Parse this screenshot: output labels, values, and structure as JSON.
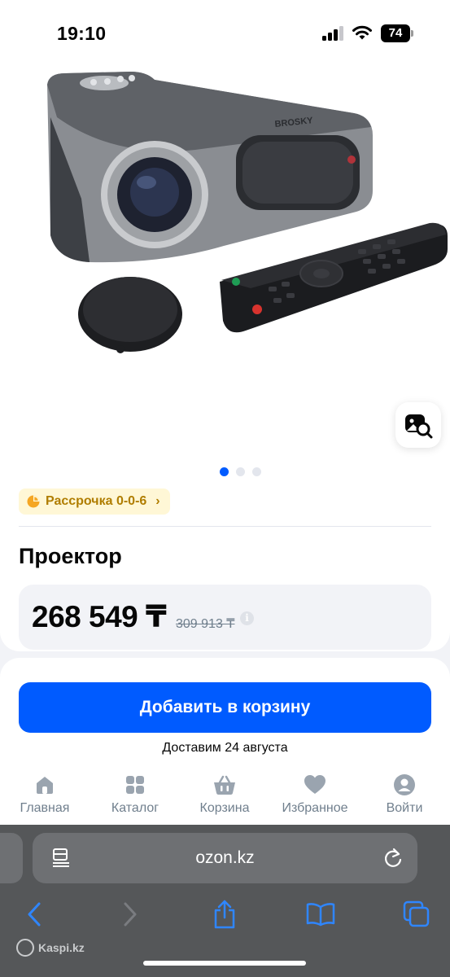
{
  "status_bar": {
    "time": "19:10",
    "battery": "74"
  },
  "product": {
    "installment_label": "Рассрочка 0-0-6",
    "title": "Проектор",
    "price": "268 549 ₸",
    "old_price": "309 913 ₸",
    "brand_on_image": "BROSKY"
  },
  "gallery": {
    "slides": 3,
    "active": 0
  },
  "actions": {
    "add_to_cart": "Добавить в корзину",
    "delivery": "Доставим 24 августа"
  },
  "tabbar": {
    "items": [
      {
        "label": "Главная",
        "icon": "home-icon"
      },
      {
        "label": "Каталог",
        "icon": "catalog-icon"
      },
      {
        "label": "Корзина",
        "icon": "cart-icon"
      },
      {
        "label": "Избранное",
        "icon": "heart-icon"
      },
      {
        "label": "Войти",
        "icon": "user-icon"
      }
    ]
  },
  "browser": {
    "url": "ozon.kz"
  },
  "watermark": "Kaspi.kz",
  "colors": {
    "accent": "#005bff",
    "installment_bg": "#fff7d6",
    "installment_text": "#b07d00"
  }
}
